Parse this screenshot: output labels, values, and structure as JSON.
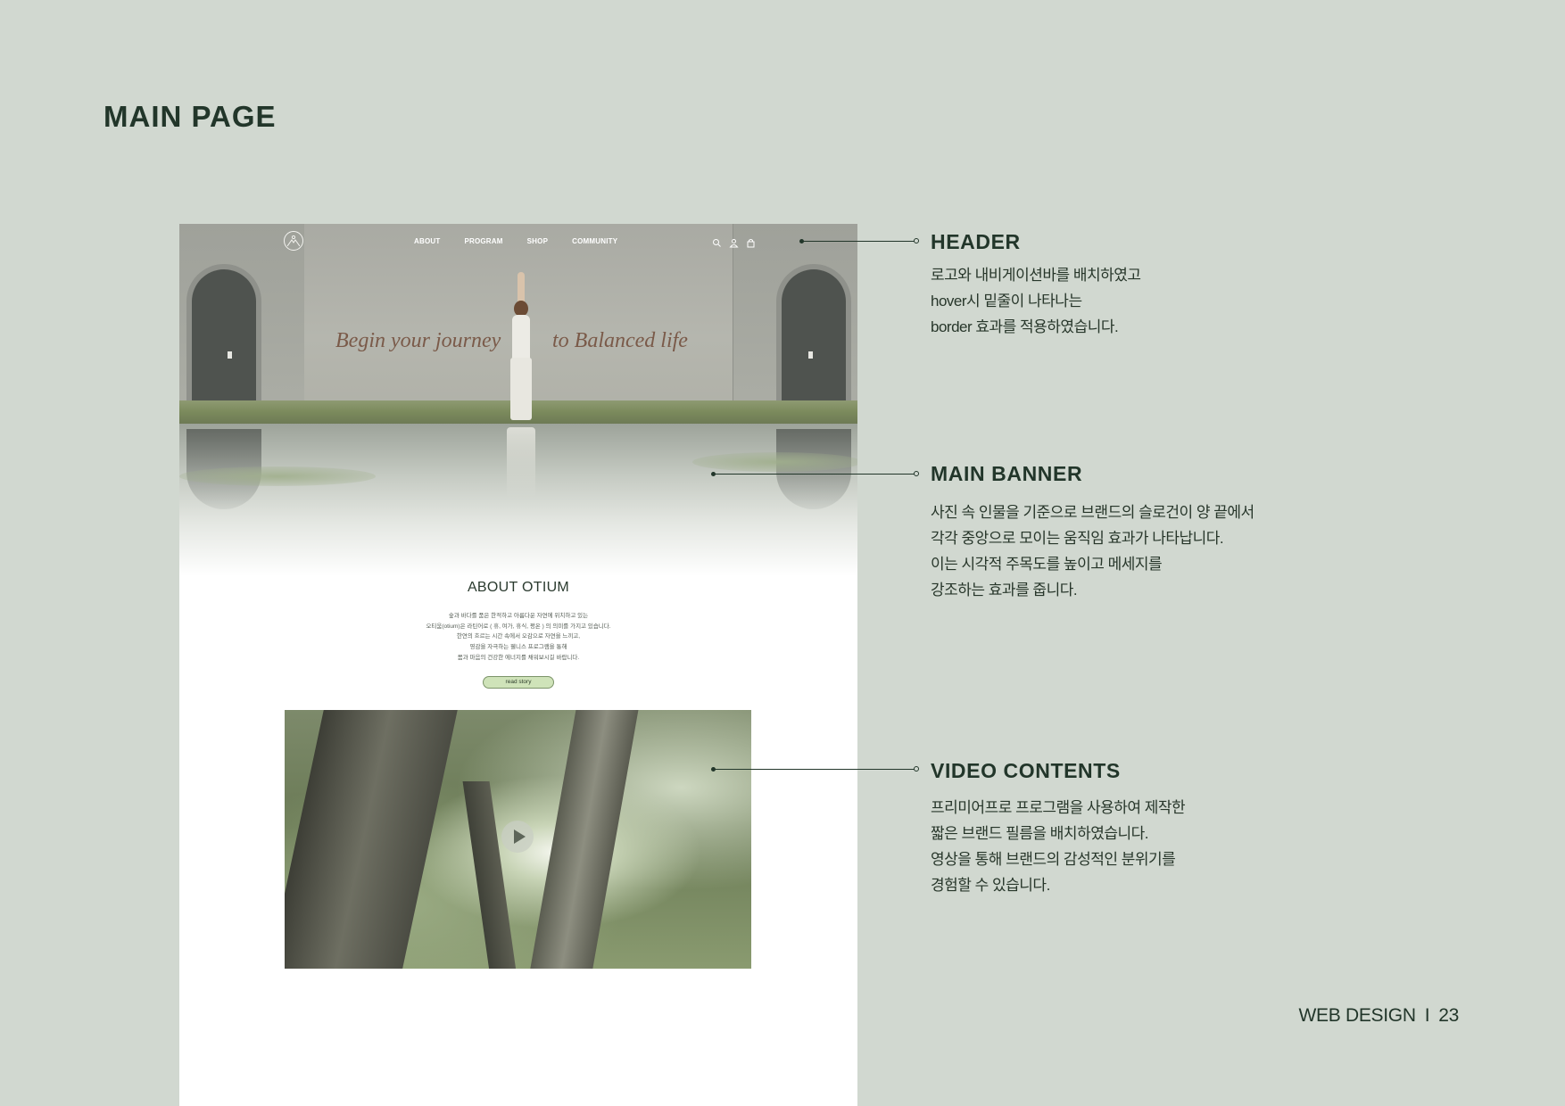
{
  "page_title": "MAIN PAGE",
  "mockup": {
    "nav": [
      "ABOUT",
      "PROGRAM",
      "SHOP",
      "COMMUNITY"
    ],
    "header_icons": [
      "search-icon",
      "user-icon",
      "cart-icon"
    ],
    "slogan_left": "Begin your journey",
    "slogan_right": "to Balanced life",
    "about_title": "ABOUT OTIUM",
    "about_lines": [
      "숲과 바다를 품은 한적하고 아름다운 자연에 위치하고 있는",
      "오티움(otium)은 라틴어로 ( 휴, 여가, 휴식, 평온 ) 의 의미를 가지고 있습니다.",
      "한연의 흐르는 시간 속에서 오감으로 자연을 느끼고,",
      "영감을 자극하는 웰니스 프로그램을 통해",
      "몸과 마음의 건강한 에너지를 채워보시길 바랍니다."
    ],
    "read_button": "read story"
  },
  "annotations": [
    {
      "title": "HEADER",
      "lines": [
        "로고와 내비게이션바를 배치하였고",
        "hover시 밑줄이 나타나는",
        "border 효과를 적용하였습니다."
      ]
    },
    {
      "title": "MAIN BANNER",
      "lines": [
        "사진 속 인물을 기준으로 브랜드의 슬로건이 양 끝에서",
        "각각 중앙으로 모이는 움직임 효과가 나타납니다.",
        "이는 시각적 주목도를 높이고 메세지를",
        "강조하는 효과를 줍니다."
      ]
    },
    {
      "title": "VIDEO CONTENTS",
      "lines": [
        "프리미어프로 프로그램을 사용하여 제작한",
        "짧은 브랜드 필름을 배치하였습니다.",
        "영상을 통해 브랜드의 감성적인 분위기를",
        "경험할 수 있습니다."
      ]
    }
  ],
  "footer": {
    "section": "WEB DESIGN",
    "separator": "I",
    "page_number": "23"
  },
  "colors": {
    "background": "#d1d8d0",
    "text_dark": "#22362a",
    "button_fill": "#cfe3b9",
    "slogan": "#7a5a49"
  }
}
